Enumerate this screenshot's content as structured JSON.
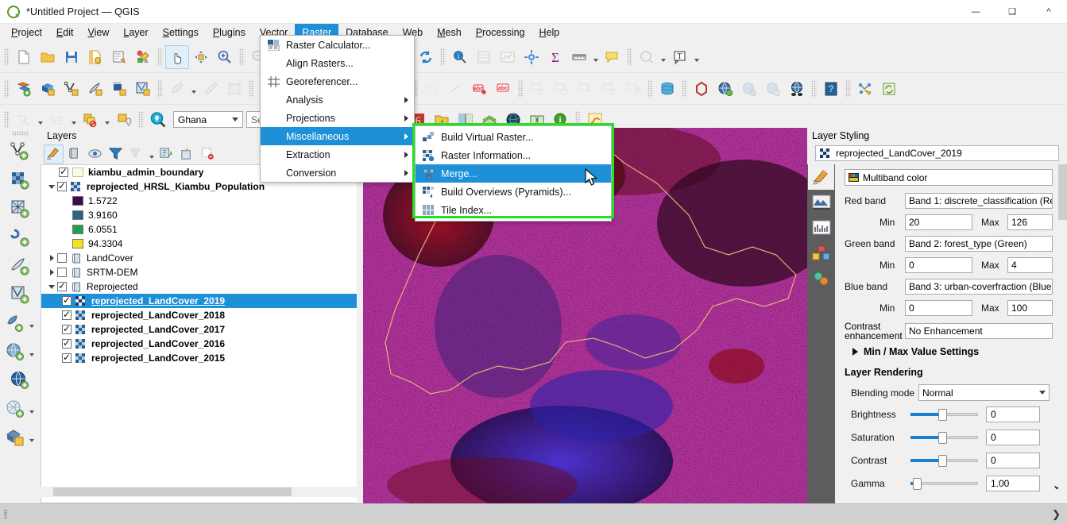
{
  "window": {
    "title": "*Untitled Project — QGIS",
    "app_icon": "qgis-logo-icon",
    "controls": {
      "minimize": "—",
      "maximize": "❐",
      "chevron": "^"
    }
  },
  "menubar": {
    "items": [
      {
        "label": "Project"
      },
      {
        "label": "Edit"
      },
      {
        "label": "View"
      },
      {
        "label": "Layer"
      },
      {
        "label": "Settings"
      },
      {
        "label": "Plugins"
      },
      {
        "label": "Vector"
      },
      {
        "label": "Raster",
        "active": true
      },
      {
        "label": "Database"
      },
      {
        "label": "Web"
      },
      {
        "label": "Mesh"
      },
      {
        "label": "Processing"
      },
      {
        "label": "Help"
      }
    ]
  },
  "raster_menu": {
    "items": [
      {
        "label": "Raster Calculator...",
        "icon": "raster-calculator-icon",
        "submenu": false
      },
      {
        "label": "Align Rasters...",
        "icon": "none",
        "submenu": false
      },
      {
        "label": "Georeferencer...",
        "icon": "georeferencer-icon",
        "submenu": false
      },
      {
        "label": "Analysis",
        "icon": "none",
        "submenu": true
      },
      {
        "label": "Projections",
        "icon": "none",
        "submenu": true
      },
      {
        "label": "Miscellaneous",
        "icon": "none",
        "submenu": true,
        "highlighted": true
      },
      {
        "label": "Extraction",
        "icon": "none",
        "submenu": true
      },
      {
        "label": "Conversion",
        "icon": "none",
        "submenu": true
      }
    ]
  },
  "miscellaneous_submenu": {
    "highlight_color": "#22e022",
    "items": [
      {
        "label": "Build Virtual Raster...",
        "icon": "build-virtual-raster-icon"
      },
      {
        "label": "Raster Information...",
        "icon": "raster-information-icon"
      },
      {
        "label": "Merge...",
        "icon": "merge-icon",
        "highlighted": true
      },
      {
        "label": "Build Overviews (Pyramids)...",
        "icon": "build-overviews-icon"
      },
      {
        "label": "Tile Index...",
        "icon": "tile-index-icon"
      }
    ]
  },
  "toolbars": {
    "row1": [
      "new-project-icon",
      "open-project-icon",
      "save-project-icon",
      "save-project-as-icon",
      "new-print-layout-icon",
      "style-manager-icon",
      "pan-map-icon",
      "pan-to-selection-icon",
      "zoom-in-icon",
      "zoom-out-icon",
      "zoom-full-icon",
      "zoom-to-selection-icon",
      "zoom-to-layer-icon",
      "zoom-last-icon",
      "zoom-next-icon",
      "refresh-icon",
      "identify-features-icon",
      "open-attribute-table-icon",
      "open-field-calculator-icon",
      "options-icon",
      "statistical-summary-icon",
      "measure-line-icon",
      "map-tips-icon",
      "show-bookmarks-icon",
      "text-annotation-icon"
    ],
    "row2": [
      "add-vector-layer-icon",
      "add-raster-layer-icon",
      "add-mesh-layer-icon",
      "add-delimited-text-icon",
      "add-spatialite-icon",
      "add-postgis-icon",
      "current-edits-icon",
      "toggle-editing-icon",
      "save-layer-edits-icon",
      "copy-features-icon",
      "paste-features-icon",
      "undo-icon",
      "redo-icon",
      "add-feature-icon",
      "vertex-tool-icon",
      "label-icon",
      "pin-labels-icon",
      "show-hide-labels-icon",
      "move-label-icon",
      "rotate-label-icon",
      "change-label-icon",
      "database-manager-icon",
      "processing-toolbox-icon",
      "metasearch-icon",
      "qgis-cloud-icon",
      "georeferencer-icon",
      "help-icon",
      "plugin-manager-icon",
      "refresh-layers-icon"
    ],
    "row3": [
      "select-features-icon",
      "deselect-features-icon",
      "select-by-location-icon",
      "zoom-to-selected-icon",
      "search-icon"
    ],
    "row3_plugins": [
      "qgis-plugin-icon",
      "python-console-icon",
      "r-script-icon",
      "open-data-source-icon",
      "split-view-icon",
      "layer-styling-icon",
      "globe-icon",
      "map-swipe-icon",
      "identify-info-icon",
      "snake-plugin-icon"
    ],
    "location_combo": {
      "value": "Ghana"
    },
    "search_field": {
      "placeholder": "Search"
    }
  },
  "left_dock": {
    "items": [
      "add-vector-layer-icon",
      "add-raster-layer-icon",
      "add-mesh-layer-icon",
      "add-delimited-text-icon",
      "add-spatialite-icon",
      "add-postgis-icon",
      "add-mssql-layer-icon",
      "add-wms-layer-icon",
      "add-wfs-layer-icon",
      "add-wcs-layer-icon",
      "add-arcgis-layer-icon"
    ]
  },
  "layers_panel": {
    "title": "Layers",
    "toolbar": [
      "open-layer-styling-icon",
      "add-group-icon",
      "manage-visibility-icon",
      "filter-legend-icon",
      "filter-legend-expression-icon",
      "expand-all-icon",
      "collapse-all-icon",
      "remove-layer-icon"
    ],
    "tree": [
      {
        "type": "layer",
        "label": "kiambu_admin_boundary",
        "checked": true,
        "icon": "vector-polygon-icon",
        "indent": 1,
        "expander": "none",
        "bold": true
      },
      {
        "type": "layer",
        "label": "reprojected_HRSL_Kiambu_Population",
        "checked": true,
        "icon": "raster-icon",
        "indent": 0,
        "expander": "down",
        "bold": true
      },
      {
        "type": "legend",
        "label": "1.5722",
        "color": "#3b0a4f",
        "indent": 2
      },
      {
        "type": "legend",
        "label": "3.9160",
        "color": "#2e6285",
        "indent": 2
      },
      {
        "type": "legend",
        "label": "6.0551",
        "color": "#21a055",
        "indent": 2
      },
      {
        "type": "legend",
        "label": "94.3304",
        "color": "#f5e31d",
        "indent": 2
      },
      {
        "type": "group",
        "label": "LandCover",
        "checked": false,
        "icon": "group-icon",
        "indent": 0,
        "expander": "right",
        "bold": false
      },
      {
        "type": "group",
        "label": "SRTM-DEM",
        "checked": false,
        "icon": "group-icon",
        "indent": 0,
        "expander": "right",
        "bold": false
      },
      {
        "type": "group",
        "label": "Reprojected",
        "checked": true,
        "icon": "group-icon",
        "indent": 0,
        "expander": "down",
        "bold": false
      },
      {
        "type": "layer",
        "label": "reprojected_LandCover_2019",
        "checked": true,
        "icon": "raster-icon",
        "indent": 1,
        "expander": "none",
        "bold": true,
        "selected": true
      },
      {
        "type": "layer",
        "label": "reprojected_LandCover_2018",
        "checked": true,
        "icon": "raster-icon",
        "indent": 1,
        "expander": "none",
        "bold": true
      },
      {
        "type": "layer",
        "label": "reprojected_LandCover_2017",
        "checked": true,
        "icon": "raster-icon",
        "indent": 1,
        "expander": "none",
        "bold": true
      },
      {
        "type": "layer",
        "label": "reprojected_LandCover_2016",
        "checked": true,
        "icon": "raster-icon",
        "indent": 1,
        "expander": "none",
        "bold": true
      },
      {
        "type": "layer",
        "label": "reprojected_LandCover_2015",
        "checked": true,
        "icon": "raster-icon",
        "indent": 1,
        "expander": "none",
        "bold": true
      }
    ]
  },
  "layer_styling": {
    "title": "Layer Styling",
    "current_layer": "reprojected_LandCover_2019",
    "tabs": [
      "symbology-icon",
      "transparency-icon",
      "histogram-icon",
      "rendering-icon",
      "legend-icon"
    ],
    "render_type": "Multiband color",
    "bands": [
      {
        "label": "Red band",
        "value": "Band 1: discrete_classification (Red)",
        "min_label": "Min",
        "min": "20",
        "max_label": "Max",
        "max": "126"
      },
      {
        "label": "Green band",
        "value": "Band 2: forest_type (Green)",
        "min_label": "Min",
        "min": "0",
        "max_label": "Max",
        "max": "4"
      },
      {
        "label": "Blue band",
        "value": "Band 3: urban-coverfraction (Blue)",
        "min_label": "Min",
        "min": "0",
        "max_label": "Max",
        "max": "100"
      }
    ],
    "contrast_label_1": "Contrast",
    "contrast_label_2": "enhancement",
    "contrast_value": "No Enhancement",
    "minmax_section": "Min / Max Value Settings",
    "rendering_section": "Layer Rendering",
    "blending_label": "Blending mode",
    "blending_value": "Normal",
    "sliders": [
      {
        "label": "Brightness",
        "value": "0",
        "pos": 47
      },
      {
        "label": "Saturation",
        "value": "0",
        "pos": 47
      },
      {
        "label": "Contrast",
        "value": "0",
        "pos": 47
      },
      {
        "label": "Gamma",
        "value": "1.00",
        "pos": 8
      }
    ]
  },
  "map": {
    "background": "#1a0208",
    "boundary_color": "#e8b87a",
    "colors": {
      "red": "#8c0308",
      "dark_red": "#3a040c",
      "blue": "#2b21a8",
      "cyan": "#3fd8c8"
    }
  },
  "statusbar": {
    "left_icon": "resize-handle-icon",
    "right_icon": "expand-icon"
  }
}
